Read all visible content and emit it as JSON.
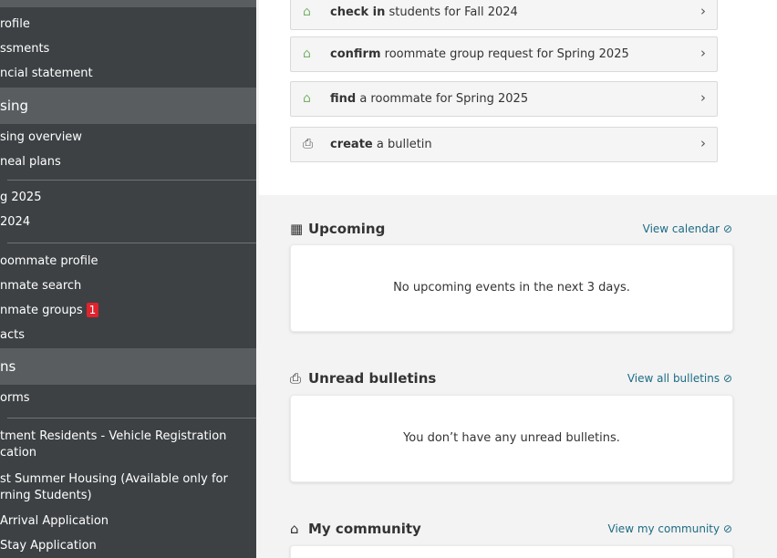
{
  "sidebar": {
    "links": [
      {
        "label": "rofile"
      },
      {
        "label": "ssments"
      },
      {
        "label": "ncial statement"
      },
      {
        "label": "sing overview"
      },
      {
        "label": "neal plans"
      },
      {
        "label": "g 2025"
      },
      {
        "label": "2024"
      },
      {
        "label": "oommate profile"
      },
      {
        "label": "nmate search"
      },
      {
        "label": "nmate groups"
      },
      {
        "label": "acts"
      },
      {
        "label": "orms"
      },
      {
        "label": "tment Residents - Vehicle Registration"
      },
      {
        "label": "cation"
      },
      {
        "label": "st Summer Housing (Available only for"
      },
      {
        "label": "rning Students)"
      },
      {
        "label": "Arrival Application"
      },
      {
        "label": "Stay Application"
      }
    ],
    "headers": [
      {
        "label": "sing"
      },
      {
        "label": "ns"
      }
    ],
    "badge": "1"
  },
  "tasks": [
    {
      "bold": "check in",
      "rest": " students for Fall 2024",
      "icon": "house-icon"
    },
    {
      "bold": "confirm",
      "rest": " roommate group request for Spring 2025",
      "icon": "house-icon"
    },
    {
      "bold": "find",
      "rest": " a roommate for Spring 2025",
      "icon": "house-icon"
    },
    {
      "bold": "create",
      "rest": " a bulletin",
      "icon": "bulletin-icon"
    }
  ],
  "upcoming": {
    "title": "Upcoming",
    "link": "View calendar",
    "empty": "No upcoming events in the next 3 days."
  },
  "bulletins": {
    "title": "Unread bulletins",
    "link": "View all bulletins",
    "empty": "You don’t have any unread bulletins."
  },
  "community": {
    "title": "My community",
    "link": "View my community"
  },
  "colors": {
    "sidebar_bg": "#3d4144",
    "sidebar_header": "#595d60",
    "link": "#1c6b84",
    "badge": "#e0232d",
    "house_icon": "#7ab36c"
  }
}
